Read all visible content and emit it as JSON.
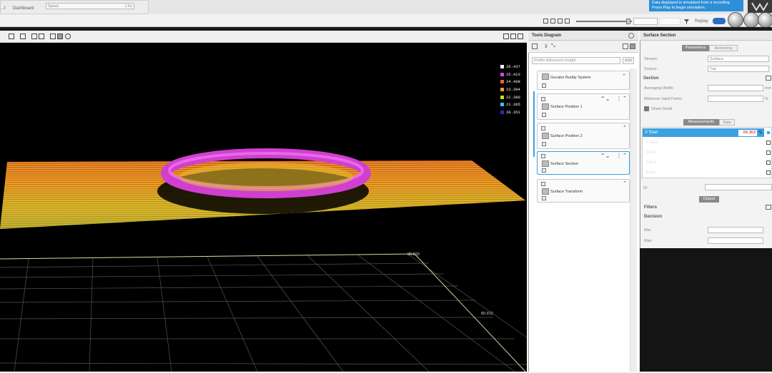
{
  "header": {
    "tab_prefix": "…t",
    "dashboard_tab": "Dashboard",
    "speed_label": "Speed:",
    "speed_value": "1 Hz",
    "simulation_notice": "Data displayed is simulated from a recording. Press Play to begin simulation.",
    "replay_label": "Replay"
  },
  "viewport": {
    "legend": [
      {
        "value": "26.437",
        "color": "#ffffff"
      },
      {
        "value": "25.423",
        "color": "#e040e0"
      },
      {
        "value": "24.408",
        "color": "#ff6030"
      },
      {
        "value": "23.394",
        "color": "#ffa020"
      },
      {
        "value": "22.380",
        "color": "#c0e020"
      },
      {
        "value": "21.365",
        "color": "#40c0ff"
      },
      {
        "value": "20.351",
        "color": "#2030c0"
      }
    ],
    "axis_label_1": "90.820",
    "axis_label_2": "60.912"
  },
  "tools": {
    "title": "Tools Diagram",
    "select_placeholder": "Profile Advanced Height",
    "add_label": "Add",
    "items": [
      {
        "name": "Gocator Buddy System"
      },
      {
        "name": "Surface Position 1"
      },
      {
        "name": "Surface Position 2"
      },
      {
        "name": "Surface Section"
      },
      {
        "name": "Surface Transform"
      }
    ]
  },
  "section": {
    "title": "Surface Section",
    "tab_parameters": "Parameters",
    "tab_anchoring": "Anchoring",
    "stream_label": "Stream:",
    "stream_value": "Surface",
    "source_label": "Source:",
    "source_value": "Top",
    "section_heading": "Section",
    "averaging_label": "Averaging Width:",
    "averaging_unit": "mm",
    "min_valid_label": "Minimum Valid Points:",
    "min_valid_unit": "%",
    "show_detail": "Show Detail",
    "measurements_tab": "Measurements",
    "data_tab": "Data",
    "measurements": [
      "X Start",
      "Y Start",
      "X End",
      "Y End",
      "Angle"
    ],
    "x_start_value": "-56.353",
    "id_label": "ID:",
    "output_tab": "Output",
    "filters_heading": "Filters",
    "decision_heading": "Decision",
    "min_label": "Min:",
    "max_label": "Max:"
  }
}
